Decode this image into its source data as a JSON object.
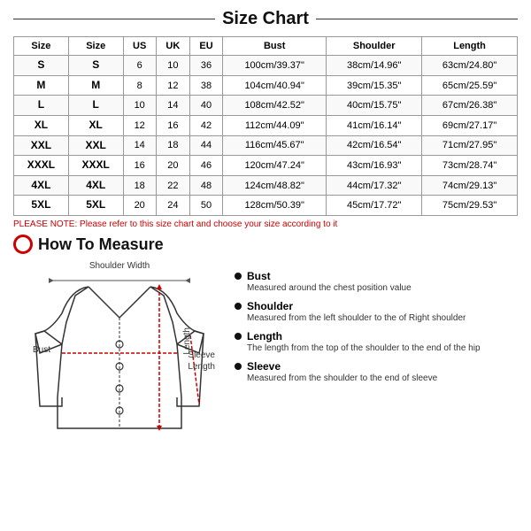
{
  "page": {
    "title": "Size Chart"
  },
  "table": {
    "headers": [
      "Size",
      "Size",
      "US",
      "UK",
      "EU",
      "Bust",
      "Shoulder",
      "Length"
    ],
    "rows": [
      [
        "S",
        "S",
        "6",
        "10",
        "36",
        "100cm/39.37\"",
        "38cm/14.96\"",
        "63cm/24.80\""
      ],
      [
        "M",
        "M",
        "8",
        "12",
        "38",
        "104cm/40.94\"",
        "39cm/15.35\"",
        "65cm/25.59\""
      ],
      [
        "L",
        "L",
        "10",
        "14",
        "40",
        "108cm/42.52\"",
        "40cm/15.75\"",
        "67cm/26.38\""
      ],
      [
        "XL",
        "XL",
        "12",
        "16",
        "42",
        "112cm/44.09\"",
        "41cm/16.14\"",
        "69cm/27.17\""
      ],
      [
        "XXL",
        "XXL",
        "14",
        "18",
        "44",
        "116cm/45.67\"",
        "42cm/16.54\"",
        "71cm/27.95\""
      ],
      [
        "XXXL",
        "XXXL",
        "16",
        "20",
        "46",
        "120cm/47.24\"",
        "43cm/16.93\"",
        "73cm/28.74\""
      ],
      [
        "4XL",
        "4XL",
        "18",
        "22",
        "48",
        "124cm/48.82\"",
        "44cm/17.32\"",
        "74cm/29.13\""
      ],
      [
        "5XL",
        "5XL",
        "20",
        "24",
        "50",
        "128cm/50.39\"",
        "45cm/17.72\"",
        "75cm/29.53\""
      ]
    ]
  },
  "note": "PLEASE NOTE: Please refer to this size chart and choose your size according to it",
  "how_to_measure": {
    "title": "How To Measure",
    "labels": {
      "shoulder_width": "Shoulder Width",
      "bust": "Bust",
      "sleeve_length": "Sleeve\nLength",
      "length": "Length"
    },
    "items": [
      {
        "title": "Bust",
        "desc": "Measured around the chest position value"
      },
      {
        "title": "Shoulder",
        "desc": "Measured from the left shoulder to the of Right shoulder"
      },
      {
        "title": "Length",
        "desc": "The length from the top of the shoulder to the end of the hip"
      },
      {
        "title": "Sleeve",
        "desc": "Measured from the shoulder to the end of sleeve"
      }
    ]
  }
}
